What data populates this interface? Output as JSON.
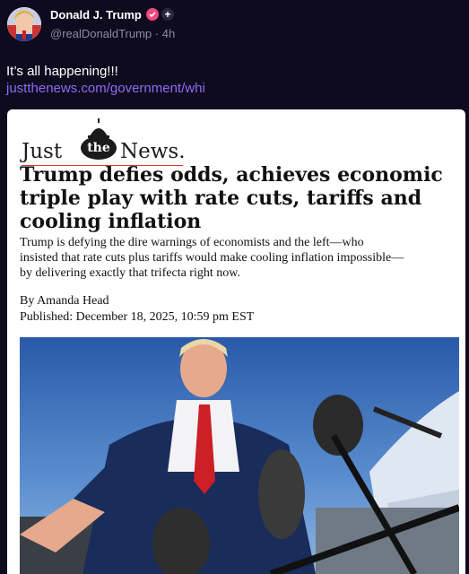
{
  "post": {
    "author_name": "Donald J. Trump",
    "handle": "@realDonaldTrump",
    "separator": "·",
    "time": "4h",
    "follow_label": "+",
    "text": "It’s all happening!!!",
    "link_text": "justthenews.com/government/whi"
  },
  "article": {
    "logo": {
      "word1": "Just",
      "word2": "the",
      "word3": "News."
    },
    "headline_lines": [
      "Trump defies odds, achieves economic",
      "triple play with rate cuts, tariffs and",
      "cooling inflation"
    ],
    "subhead_lines": [
      "Trump is defying the dire warnings of economists and the left—who",
      "insisted that rate cuts plus tariffs would make cooling inflation impossible—",
      "by delivering exactly that trifecta right now."
    ],
    "byline": "By Amanda Head",
    "published": "Published: December 18, 2025, 10:59 pm EST"
  },
  "colors": {
    "background": "#0f0b1f",
    "link": "#8c6cf5",
    "verified_badge": "#f0487f",
    "handle": "#8d87a6"
  },
  "icons": {
    "avatar": "avatar-image",
    "verified": "verified-badge-icon",
    "follow": "plus-icon"
  }
}
